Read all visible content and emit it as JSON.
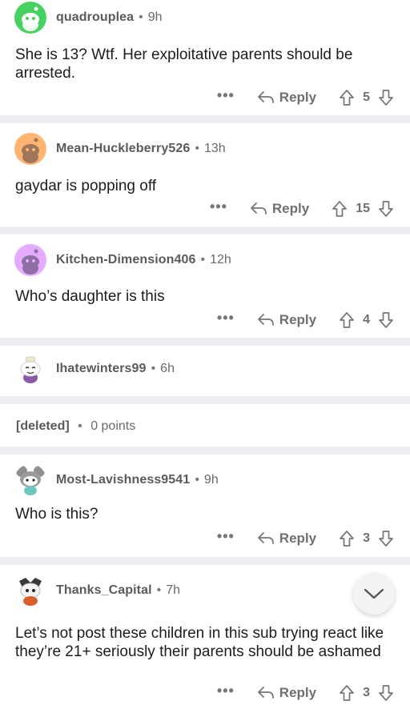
{
  "comments": [
    {
      "username": "quadrouplea",
      "time": "9h",
      "body": "She is 13? Wtf. Her exploitative parents should be arrested.",
      "more": "•••",
      "reply_label": "Reply",
      "votes": "5",
      "avatar_color": "#46d160"
    },
    {
      "username": "Mean-Huckleberry526",
      "time": "13h",
      "body": "gaydar is popping off",
      "more": "•••",
      "reply_label": "Reply",
      "votes": "15",
      "avatar_color": "#ffb470"
    },
    {
      "username": "Kitchen-Dimension406",
      "time": "12h",
      "body": "Who’s daughter is this",
      "more": "•••",
      "reply_label": "Reply",
      "votes": "4",
      "avatar_color": "#e4abff"
    },
    {
      "username": "Ihatewinters99",
      "time": "6h"
    },
    {
      "deleted_label": "[deleted]",
      "points": "0 points"
    },
    {
      "username": "Most-Lavishness9541",
      "time": "9h",
      "body": "Who is this?",
      "more": "•••",
      "reply_label": "Reply",
      "votes": "3"
    },
    {
      "username": "Thanks_Capital",
      "time": "7h",
      "body": "Let’s not post these children in this sub trying react like they’re 21+ seriously their parents should be ashamed",
      "more": "•••",
      "reply_label": "Reply",
      "votes": "3"
    }
  ],
  "separator": "•",
  "icons": {
    "reply": "reply-arrow-icon",
    "upvote": "upvote-arrow-icon",
    "downvote": "downvote-arrow-icon",
    "scroll": "chevron-down-icon"
  }
}
